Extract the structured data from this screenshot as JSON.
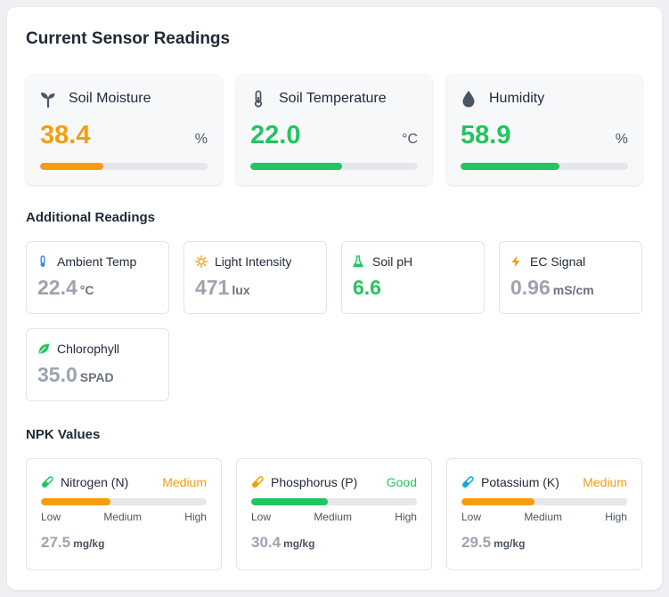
{
  "title": "Current Sensor Readings",
  "main_cards": [
    {
      "label": "Soil Moisture",
      "value": "38.4",
      "unit": "%",
      "icon": "sprout-icon",
      "color": "#f59e0b",
      "level": 0.38
    },
    {
      "label": "Soil Temperature",
      "value": "22.0",
      "unit": "°C",
      "icon": "thermometer-icon",
      "color": "#22c55e",
      "level": 0.55
    },
    {
      "label": "Humidity",
      "value": "58.9",
      "unit": "%",
      "icon": "droplet-icon",
      "color": "#22c55e",
      "level": 0.59
    }
  ],
  "additional": {
    "title": "Additional Readings",
    "items": [
      {
        "label": "Ambient Temp",
        "value": "22.4",
        "unit": "°C",
        "icon": "thermometer-icon",
        "icon_color": "#3b82f6",
        "value_color": "#9ca3af"
      },
      {
        "label": "Light Intensity",
        "value": "471",
        "unit": "lux",
        "icon": "sun-icon",
        "icon_color": "#f59e0b",
        "value_color": "#9ca3af"
      },
      {
        "label": "Soil pH",
        "value": "6.6",
        "unit": "",
        "icon": "flask-icon",
        "icon_color": "#22c55e",
        "value_color": "#22c55e"
      },
      {
        "label": "EC Signal",
        "value": "0.96",
        "unit": "mS/cm",
        "icon": "bolt-icon",
        "icon_color": "#f59e0b",
        "value_color": "#9ca3af"
      },
      {
        "label": "Chlorophyll",
        "value": "35.0",
        "unit": "SPAD",
        "icon": "leaf-icon",
        "icon_color": "#22c55e",
        "value_color": "#9ca3af"
      }
    ]
  },
  "npk": {
    "title": "NPK Values",
    "scale": [
      "Low",
      "Medium",
      "High"
    ],
    "items": [
      {
        "label": "Nitrogen (N)",
        "status": "Medium",
        "status_color": "#f59e0b",
        "value": "27.5",
        "unit": "mg/kg",
        "icon": "test-tube-icon",
        "icon_color": "#22c55e",
        "fill_color": "#f59e0b",
        "level": 0.42
      },
      {
        "label": "Phosphorus (P)",
        "status": "Good",
        "status_color": "#22c55e",
        "value": "30.4",
        "unit": "mg/kg",
        "icon": "test-tube-icon",
        "icon_color": "#f59e0b",
        "fill_color": "#22c55e",
        "level": 0.46
      },
      {
        "label": "Potassium (K)",
        "status": "Medium",
        "status_color": "#f59e0b",
        "value": "29.5",
        "unit": "mg/kg",
        "icon": "test-tube-icon",
        "icon_color": "#0ea5e9",
        "fill_color": "#f59e0b",
        "level": 0.44
      }
    ]
  }
}
